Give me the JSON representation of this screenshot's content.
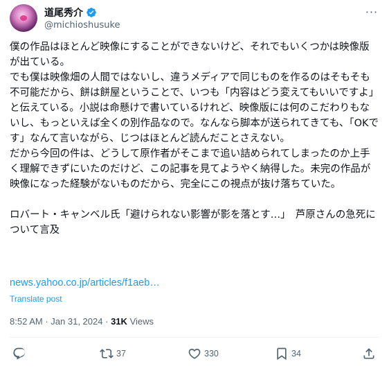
{
  "author": {
    "display_name": "道尾秀介",
    "handle": "@michioshusuke"
  },
  "more_label": "···",
  "body_paragraphs": [
    "僕の作品はほとんど映像にすることができないけど、それでもいくつかは映像版が出ている。",
    "でも僕は映像畑の人間ではないし、違うメディアで同じものを作るのはそもそも不可能だから、餅は餅屋ということで、いつも「内容はどう変えてもいいですよ」と伝えている。小説は命懸けで書いているけれど、映像版には何のこだわりもないし、もっといえば全くの別作品なので。なんなら脚本が送られてきても、「OKです」なんて言いながら、じつはほとんど読んだことさえない。",
    "だから今回の件は、どうして原作者がそこまで追い詰められてしまったのか上手く理解できずにいたのだけど、この記事を見てようやく納得した。未完の作品が映像になった経験がないものだから、完全にこの視点が抜け落ちていた。",
    "",
    "ロバート・キャンベル氏「避けられない影響が影を落とす…」　芦原さんの急死について言及"
  ],
  "link_text": "news.yahoo.co.jp/articles/f1aeb…",
  "translate_label": "Translate post",
  "meta": {
    "time": "8:52 AM",
    "date": "Jan 31, 2024",
    "separator": "·",
    "views_count": "31K",
    "views_label": "Views"
  },
  "actions": {
    "reply_count": "",
    "retweet_count": "37",
    "like_count": "330",
    "bookmark_count": "34"
  },
  "colors": {
    "accent": "#1d9bf0",
    "text": "#0f1419",
    "muted": "#536471"
  }
}
